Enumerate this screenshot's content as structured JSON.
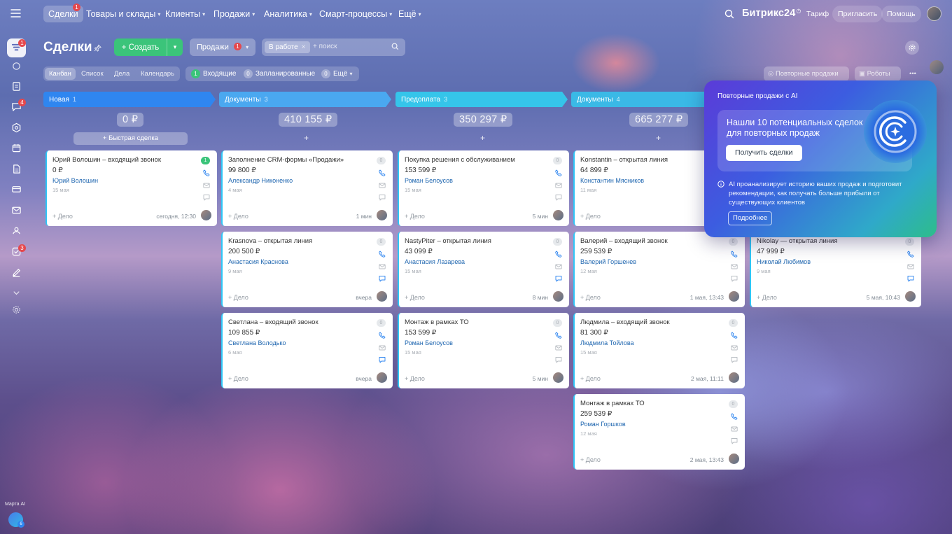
{
  "topbar": {
    "nav": [
      {
        "label": "Сделки",
        "badge": "1"
      },
      {
        "label": "Товары и склады"
      },
      {
        "label": "Клиенты"
      },
      {
        "label": "Продажи"
      },
      {
        "label": "Аналитика"
      },
      {
        "label": "Смарт-процессы"
      },
      {
        "label": "Ещё"
      }
    ],
    "logo": "Битрикс24",
    "tariff": "Тариф",
    "invite": "Пригласить",
    "help": "Помощь"
  },
  "sidebar": {
    "badges": {
      "crm": "1",
      "chat": "4",
      "tasks": "3"
    },
    "ai_label": "Марта AI",
    "ai_badge": "6"
  },
  "header": {
    "title": "Сделки",
    "create_label": "Создать",
    "sales_select": "Продажи",
    "sales_badge": "1",
    "filter_chip": "В работе",
    "search_placeholder": "+ поиск"
  },
  "view_tabs": [
    "Канбан",
    "Список",
    "Дела",
    "Календарь"
  ],
  "filters": [
    {
      "count": "1",
      "label": "Входящие"
    },
    {
      "count": "0",
      "label": "Запланированные"
    },
    {
      "count": "0",
      "label": "Ещё"
    }
  ],
  "toolbar_right": {
    "repeat_sales": "Повторные продажи",
    "robots": "Роботы"
  },
  "quick_deal": "+ Быстрая сделка",
  "task_label": "+ Дело",
  "columns": [
    {
      "name": "Новая",
      "count": "1",
      "sum": "0 ₽",
      "color": "#2f86f0"
    },
    {
      "name": "Документы",
      "count": "3",
      "sum": "410 155 ₽",
      "color": "#4aa8f0"
    },
    {
      "name": "Предоплата",
      "count": "3",
      "sum": "350 297 ₽",
      "color": "#35c5ea"
    },
    {
      "name": "Документы",
      "count": "4",
      "sum": "665 277 ₽",
      "color": "#3ab9e6"
    }
  ],
  "cards": [
    {
      "title": "Юрий Волошин – входящий звонок",
      "sum": "0 ₽",
      "person": "Юрий Волошин",
      "date": "15 мая",
      "time": "сегодня, 12:30",
      "counter": "1"
    },
    {
      "title": "Заполнение CRM-формы «Продажи»",
      "sum": "99 800 ₽",
      "person": "Александр Никоненко",
      "date": "4 мая",
      "time": "1 мин",
      "counter": "0"
    },
    {
      "title": "Krasnova – открытая линия",
      "sum": "200 500 ₽",
      "person": "Анастасия Краснова",
      "date": "9 мая",
      "time": "вчера",
      "counter": "0"
    },
    {
      "title": "Светлана – входящий звонок",
      "sum": "109 855 ₽",
      "person": "Светлана Володько",
      "date": "6 мая",
      "time": "вчера",
      "counter": "0"
    },
    {
      "title": "Покупка решения с обслуживанием",
      "sum": "153 599 ₽",
      "person": "Роман Белоусов",
      "date": "15 мая",
      "time": "5 мин",
      "counter": "0"
    },
    {
      "title": "NastyPiter – открытая линия",
      "sum": "43 099 ₽",
      "person": "Анастасия Лазарева",
      "date": "15 мая",
      "time": "8 мин",
      "counter": "0"
    },
    {
      "title": "Монтаж в рамках ТО",
      "sum": "153 599 ₽",
      "person": "Роман Белоусов",
      "date": "15 мая",
      "time": "5 мин",
      "counter": "0"
    },
    {
      "title": "Konstantin – открытая линия",
      "sum": "64 899 ₽",
      "person": "Константин Мясников",
      "date": "11 мая",
      "time": "1 мая",
      "counter": "0"
    },
    {
      "title": "Валерий – входящий звонок",
      "sum": "259 539 ₽",
      "person": "Валерий Горшенев",
      "date": "12 мая",
      "time": "1 мая, 13:43",
      "counter": "0"
    },
    {
      "title": "Людмила – входящий звонок",
      "sum": "81 300 ₽",
      "person": "Людмила Тойлова",
      "date": "15 мая",
      "time": "2 мая, 11:11",
      "counter": "0"
    },
    {
      "title": "Монтаж в рамках ТО",
      "sum": "259 539 ₽",
      "person": "Роман Горшков",
      "date": "12 мая",
      "time": "2 мая, 13:43",
      "counter": "0"
    },
    {
      "title": "Nikolay — открытая линия",
      "sum": "47 999 ₽",
      "person": "Николай Любимов",
      "date": "9 мая",
      "time": "5 мая, 10:43",
      "counter": "0"
    }
  ],
  "ai_popup": {
    "header": "Повторные продажи с AI",
    "message": "Нашли 10 потенциальных сделок для повторных продаж",
    "get_button": "Получить сделки",
    "info": "AI проанализирует историю ваших продаж и подготовит рекомендации, как получать больше прибыли от существующих клиентов",
    "more_button": "Подробнее"
  }
}
